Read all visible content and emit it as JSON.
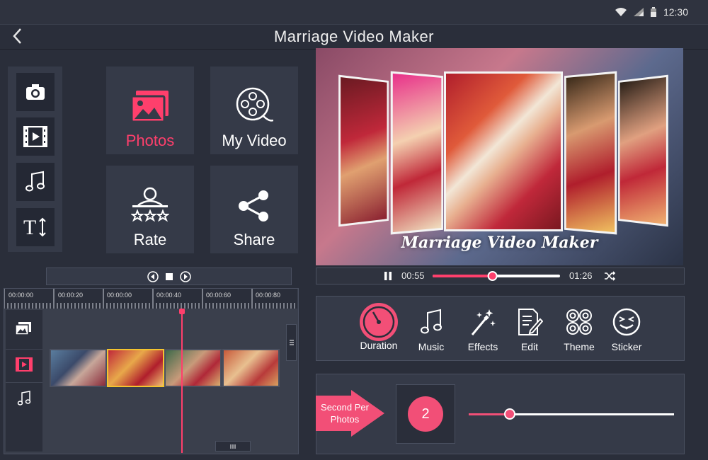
{
  "status": {
    "time": "12:30"
  },
  "app": {
    "title": "Marriage Video Maker"
  },
  "menu": {
    "photos": "Photos",
    "my_video": "My Video",
    "rate": "Rate",
    "share": "Share"
  },
  "timeline": {
    "ticks": [
      "00:00:00",
      "00:00:20",
      "00:00:00",
      "00:00:40",
      "00:00:60",
      "00:00:80"
    ]
  },
  "preview": {
    "overlay_title": "Marriage Video Maker"
  },
  "player": {
    "current_time": "00:55",
    "total_time": "01:26",
    "progress": 0.47
  },
  "features": [
    {
      "label": "Duration",
      "icon": "timer-icon"
    },
    {
      "label": "Music",
      "icon": "music-note-icon"
    },
    {
      "label": "Effects",
      "icon": "magic-wand-icon"
    },
    {
      "label": "Edit",
      "icon": "edit-icon"
    },
    {
      "label": "Theme",
      "icon": "theme-grid-icon"
    },
    {
      "label": "Sticker",
      "icon": "sticker-icon"
    }
  ],
  "seconds_panel": {
    "label": "Second Per Photos",
    "value": "2",
    "slider_level": 0.2
  },
  "colors": {
    "accent": "#ff3f6c",
    "panel": "#353a48",
    "background": "#2a2e3a"
  }
}
